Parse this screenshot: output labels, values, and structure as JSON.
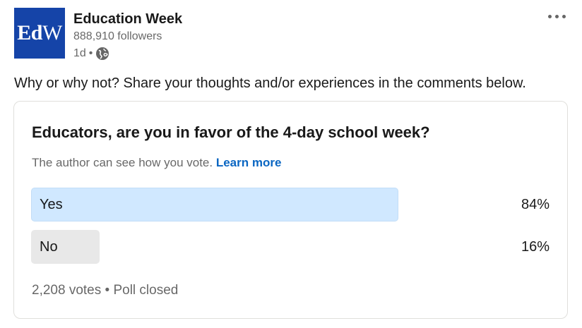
{
  "author": {
    "logo_text_bold": "Ed",
    "logo_text_regular": "W",
    "name": "Education Week",
    "followers": "888,910 followers",
    "time": "1d",
    "separator": "•",
    "visibility_icon": "globe-icon",
    "brand_color": "#1544a8"
  },
  "post": {
    "text": "Why or why not? Share your thoughts and/or experiences in the comments below."
  },
  "poll": {
    "question": "Educators, are you in favor of the 4-day school week?",
    "notice": "The author can see how you vote.",
    "learn_more": "Learn more",
    "options": [
      {
        "label": "Yes",
        "percent_label": "84%",
        "percent": 84,
        "bar_color": "#d0e8ff"
      },
      {
        "label": "No",
        "percent_label": "16%",
        "percent": 16,
        "bar_color": "#e8e8e8"
      }
    ],
    "votes": "2,208 votes",
    "footer_separator": "•",
    "status": "Poll closed"
  },
  "accent_color": "#0a66c2"
}
